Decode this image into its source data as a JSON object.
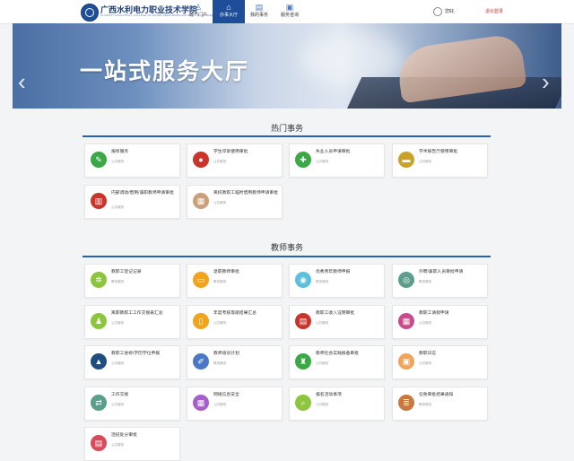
{
  "header": {
    "school_name": "广西水利电力职业技术学院",
    "school_name_en": "GUANGXI VOCATIONAL COLLEGE OF WATER RESOURCES AND ELECTRIC POWER",
    "nav": [
      {
        "label": "统一门户",
        "icon": "person-icon"
      },
      {
        "label": "办事大厅",
        "icon": "home-icon",
        "active": true
      },
      {
        "label": "我的事务",
        "icon": "document-icon"
      },
      {
        "label": "服务咨询",
        "icon": "chat-icon"
      }
    ],
    "user_name": "您好,",
    "logout_label": "退出登录"
  },
  "banner": {
    "title": "一站式服务大厅",
    "prev": "‹",
    "next": "›"
  },
  "hot": {
    "title": "热门事务",
    "items": [
      {
        "name": "报修服务",
        "sub": "公共服务",
        "color": "#3aa845",
        "icon": "wrench-icon"
      },
      {
        "name": "学生印章使用审批",
        "sub": "公共服务",
        "color": "#c9342b",
        "icon": "stamp-icon"
      },
      {
        "name": "失业人员申请审批",
        "sub": "公共服务",
        "color": "#3aa845",
        "icon": "plus-icon"
      },
      {
        "name": "学术报告厅使用审批",
        "sub": "公共服务",
        "color": "#c9a227",
        "icon": "podium-icon"
      },
      {
        "name": "内部调动/借用/兼职教师申请审批",
        "sub": "公共服务",
        "color": "#c9342b",
        "icon": "train-icon"
      },
      {
        "name": "离校教职工临时借用教师申请审批",
        "sub": "公共服务",
        "color": "#c9a07a",
        "icon": "bus-icon"
      }
    ]
  },
  "teacher": {
    "title": "教师事务",
    "items": [
      {
        "name": "教职工登记记录",
        "sub": "教务服务",
        "color": "#8cc63e",
        "icon": "network-icon"
      },
      {
        "name": "退职教师审批",
        "sub": "教务服务",
        "color": "#f1a31c",
        "icon": "folder-icon"
      },
      {
        "name": "优秀青年教师申报",
        "sub": "教务服务",
        "color": "#5bc0de",
        "icon": "people-icon"
      },
      {
        "name": "外聘/兼职人员审批申请",
        "sub": "教务服务",
        "color": "#5b9e8c",
        "icon": "group-icon"
      },
      {
        "name": "离职教职工工作交接表汇总",
        "sub": "公共服务",
        "color": "#8cc63e",
        "icon": "team-icon"
      },
      {
        "name": "年度考核等级结果汇总",
        "sub": "公共服务",
        "color": "#f1a31c",
        "icon": "id-card-icon"
      },
      {
        "name": "教职工收入证明审批",
        "sub": "公共服务",
        "color": "#c9342b",
        "icon": "receipt-icon"
      },
      {
        "name": "教职工请假申请",
        "sub": "公共服务",
        "color": "#c84b8b",
        "icon": "calendar-icon"
      },
      {
        "name": "教职工进修/学历学位申报",
        "sub": "公共服务",
        "color": "#1e4d80",
        "icon": "graduation-icon"
      },
      {
        "name": "教师培训计划",
        "sub": "教务服务",
        "color": "#4a78c4",
        "icon": "clipboard-icon"
      },
      {
        "name": "教师社会实践报备审批",
        "sub": "公共服务",
        "color": "#3aa845",
        "icon": "building-icon"
      },
      {
        "name": "教职日志",
        "sub": "公共服务",
        "color": "#f0a35a",
        "icon": "notebook-icon"
      },
      {
        "name": "工作交接",
        "sub": "公共服务",
        "color": "#5b9e8c",
        "icon": "exchange-icon"
      },
      {
        "name": "网络信息安全",
        "sub": "公共服务",
        "color": "#a55fc9",
        "icon": "grid-icon"
      },
      {
        "name": "报名活动事项",
        "sub": "公共服务",
        "color": "#8cc63e",
        "icon": "magnifier-icon"
      },
      {
        "name": "任免审批结果通知",
        "sub": "教务服务",
        "color": "#c9783f",
        "icon": "doc-list-icon"
      },
      {
        "name": "违纪处分审批",
        "sub": "公共服务",
        "color": "#d84b5a",
        "icon": "form-icon"
      }
    ]
  }
}
